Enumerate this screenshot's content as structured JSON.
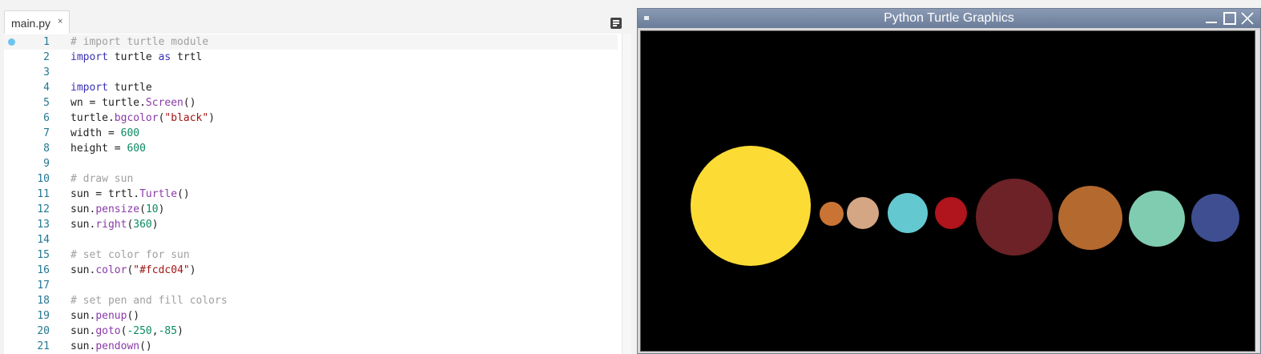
{
  "editor": {
    "tab_label": "main.py",
    "tab_close": "×",
    "active_line": 1,
    "breakpoint_line": 1,
    "lines": [
      {
        "n": "1",
        "tokens": [
          {
            "t": "# import turtle module",
            "c": "comment"
          }
        ]
      },
      {
        "n": "2",
        "tokens": [
          {
            "t": "import",
            "c": "kw"
          },
          {
            "t": " turtle ",
            "c": "plain"
          },
          {
            "t": "as",
            "c": "kw"
          },
          {
            "t": " trtl",
            "c": "plain"
          }
        ]
      },
      {
        "n": "3",
        "tokens": []
      },
      {
        "n": "4",
        "tokens": [
          {
            "t": "import",
            "c": "kw"
          },
          {
            "t": " turtle",
            "c": "plain"
          }
        ]
      },
      {
        "n": "5",
        "tokens": [
          {
            "t": "wn = turtle.",
            "c": "plain"
          },
          {
            "t": "Screen",
            "c": "fn"
          },
          {
            "t": "()",
            "c": "plain"
          }
        ]
      },
      {
        "n": "6",
        "tokens": [
          {
            "t": "turtle.",
            "c": "plain"
          },
          {
            "t": "bgcolor",
            "c": "fn"
          },
          {
            "t": "(",
            "c": "plain"
          },
          {
            "t": "\"black\"",
            "c": "str"
          },
          {
            "t": ")",
            "c": "plain"
          }
        ]
      },
      {
        "n": "7",
        "tokens": [
          {
            "t": "width = ",
            "c": "plain"
          },
          {
            "t": "600",
            "c": "num"
          }
        ]
      },
      {
        "n": "8",
        "tokens": [
          {
            "t": "height = ",
            "c": "plain"
          },
          {
            "t": "600",
            "c": "num"
          }
        ]
      },
      {
        "n": "9",
        "tokens": []
      },
      {
        "n": "10",
        "tokens": [
          {
            "t": "# draw sun",
            "c": "comment"
          }
        ]
      },
      {
        "n": "11",
        "tokens": [
          {
            "t": "sun = trtl.",
            "c": "plain"
          },
          {
            "t": "Turtle",
            "c": "fn"
          },
          {
            "t": "()",
            "c": "plain"
          }
        ]
      },
      {
        "n": "12",
        "tokens": [
          {
            "t": "sun.",
            "c": "plain"
          },
          {
            "t": "pensize",
            "c": "fn"
          },
          {
            "t": "(",
            "c": "plain"
          },
          {
            "t": "10",
            "c": "num"
          },
          {
            "t": ")",
            "c": "plain"
          }
        ]
      },
      {
        "n": "13",
        "tokens": [
          {
            "t": "sun.",
            "c": "plain"
          },
          {
            "t": "right",
            "c": "fn"
          },
          {
            "t": "(",
            "c": "plain"
          },
          {
            "t": "360",
            "c": "num"
          },
          {
            "t": ")",
            "c": "plain"
          }
        ]
      },
      {
        "n": "14",
        "tokens": []
      },
      {
        "n": "15",
        "tokens": [
          {
            "t": "# set color for sun",
            "c": "comment"
          }
        ]
      },
      {
        "n": "16",
        "tokens": [
          {
            "t": "sun.",
            "c": "plain"
          },
          {
            "t": "color",
            "c": "fn"
          },
          {
            "t": "(",
            "c": "plain"
          },
          {
            "t": "\"#fcdc04\"",
            "c": "str"
          },
          {
            "t": ")",
            "c": "plain"
          }
        ]
      },
      {
        "n": "17",
        "tokens": []
      },
      {
        "n": "18",
        "tokens": [
          {
            "t": "# set pen and fill colors",
            "c": "comment"
          }
        ]
      },
      {
        "n": "19",
        "tokens": [
          {
            "t": "sun.",
            "c": "plain"
          },
          {
            "t": "penup",
            "c": "fn"
          },
          {
            "t": "()",
            "c": "plain"
          }
        ]
      },
      {
        "n": "20",
        "tokens": [
          {
            "t": "sun.",
            "c": "plain"
          },
          {
            "t": "goto",
            "c": "fn"
          },
          {
            "t": "(",
            "c": "plain"
          },
          {
            "t": "-250",
            "c": "num"
          },
          {
            "t": ",",
            "c": "plain"
          },
          {
            "t": "-85",
            "c": "num"
          },
          {
            "t": ")",
            "c": "plain"
          }
        ]
      },
      {
        "n": "21",
        "tokens": [
          {
            "t": "sun.",
            "c": "plain"
          },
          {
            "t": "pendown",
            "c": "fn"
          },
          {
            "t": "()",
            "c": "plain"
          }
        ]
      }
    ]
  },
  "turtle_window": {
    "title": "Python Turtle Graphics",
    "canvas_bg": "#000000",
    "bodies": [
      {
        "name": "sun",
        "color": "#fcdc34"
      },
      {
        "name": "mercury",
        "color": "#c97434"
      },
      {
        "name": "venus",
        "color": "#d4a684"
      },
      {
        "name": "earth",
        "color": "#64c8d0"
      },
      {
        "name": "mars",
        "color": "#b0141c"
      },
      {
        "name": "jupiter",
        "color": "#6c2226"
      },
      {
        "name": "saturn",
        "color": "#b4692e"
      },
      {
        "name": "uranus",
        "color": "#80ccb0"
      },
      {
        "name": "neptune",
        "color": "#3e4e90"
      }
    ]
  }
}
